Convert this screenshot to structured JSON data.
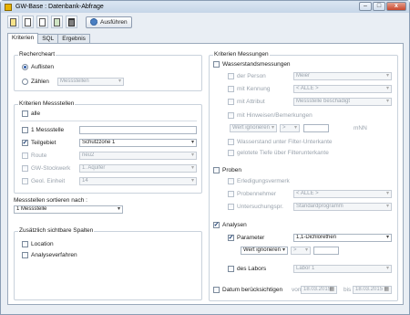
{
  "window": {
    "title": "GW-Base : Datenbank-Abfrage",
    "min": "–",
    "max": "□",
    "close": "x"
  },
  "toolbar": {
    "run_label": "Ausführen"
  },
  "tabs": [
    "Kriterien",
    "SQL",
    "Ergebnis"
  ],
  "left": {
    "search_type": {
      "title": "Recherche­art",
      "options": [
        "Auflisten",
        "Zählen"
      ],
      "count_value": "Messstellen"
    },
    "kriterien_messstellen": {
      "title": "Kriterien Messstellen",
      "alle": "alle",
      "rows": [
        {
          "label": "1 Messstelle",
          "value": ""
        },
        {
          "label": "Teilgebiet",
          "value": "Schutzzone 1"
        },
        {
          "label": "Route",
          "value": "neu2"
        },
        {
          "label": "GW-Stockwerk",
          "value": "1. Aquifer"
        },
        {
          "label": "Geol. Einheit",
          "value": "14"
        }
      ]
    },
    "sort": {
      "label": "Messstellen sortieren nach :",
      "value": "1 Messstelle"
    },
    "extra_cols": {
      "title": "Zusätzlich sichtbare Spalten",
      "items": [
        "Location",
        "Analyseverfahren"
      ]
    }
  },
  "right": {
    "title": "Kriterien Messungen",
    "wasser": {
      "label": "Wasserstandsmessungen",
      "rows": [
        {
          "label": "der Person",
          "value": "Meier"
        },
        {
          "label": "mit Kennung",
          "value": "< ALLE >"
        },
        {
          "label": "mit Attribut",
          "value": "Messstelle beschädigt"
        }
      ],
      "hinweise": "mit Hinweisen/Bemerkungen",
      "wert": "Wert ignorieren",
      "op": ">",
      "unit": "mNN",
      "unter": "Wasserstand unter Filter-Unterkante",
      "tiefe": "gelotete Tiefe über Filterunterkante"
    },
    "proben": {
      "label": "Proben",
      "erledigung": "Erledigungsvermerk",
      "rows": [
        {
          "label": "Probennehmer",
          "value": "< ALLE >"
        },
        {
          "label": "Untersuchungspr.",
          "value": "Standardprogramm"
        }
      ]
    },
    "analysen": {
      "label": "Analysen",
      "parameter": "Parameter",
      "param_value": "1,1-Dichlorethen",
      "wert": "Wert ignorieren",
      "op": ">",
      "labor_label": "des Labors",
      "labor_value": "Labor 1"
    },
    "datum": {
      "label": "Datum berücksichtigen",
      "von": "von",
      "von_value": "18.03.2015",
      "bis": "bis",
      "bis_value": "18.03.2015"
    }
  }
}
